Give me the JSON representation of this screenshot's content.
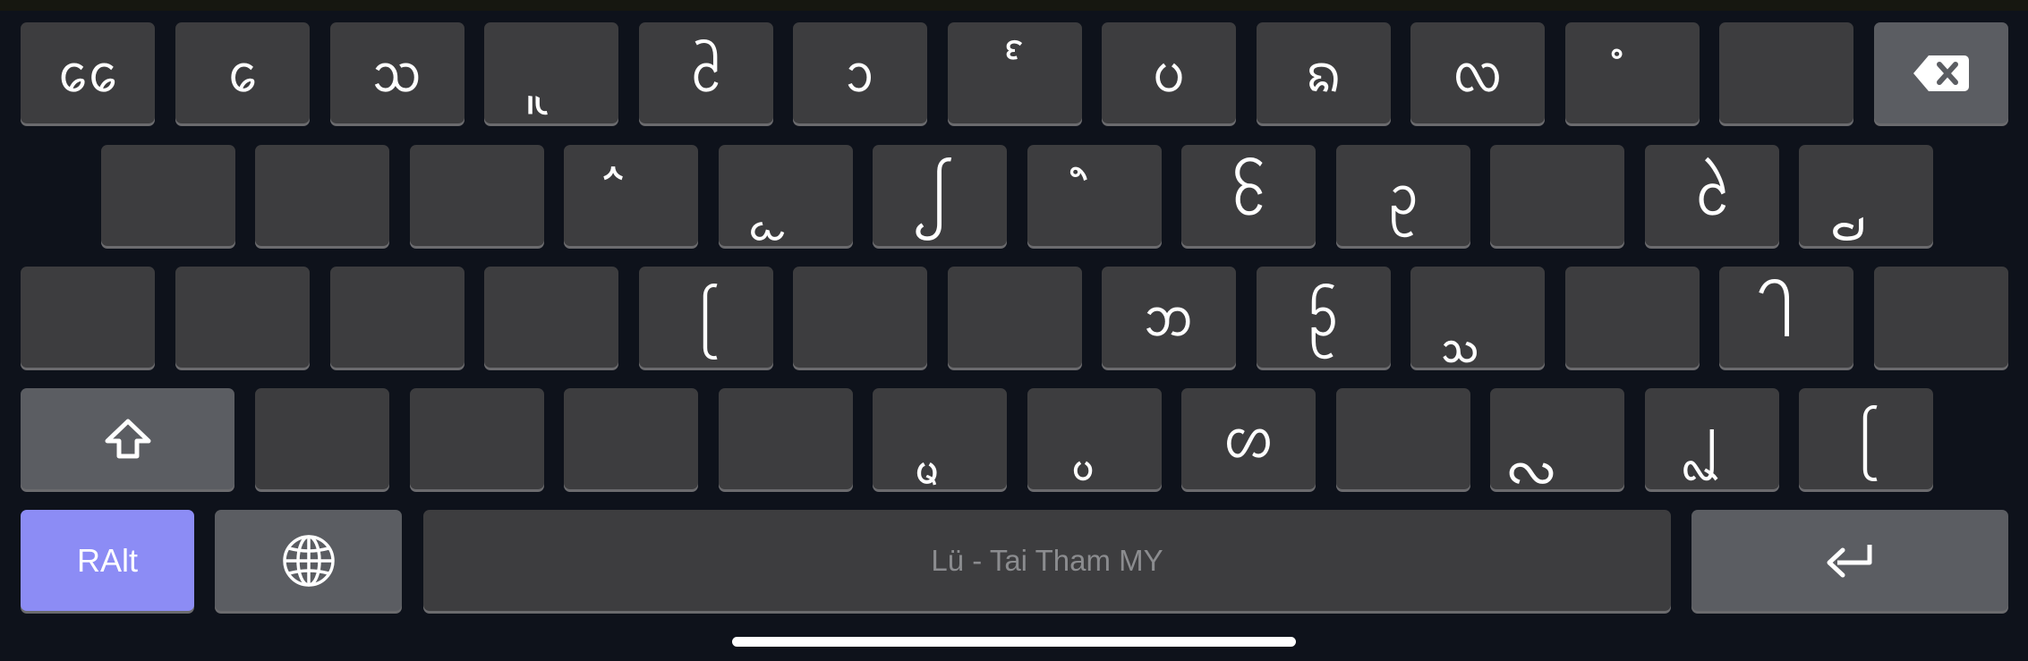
{
  "keyboard": {
    "layout_name": "Lü - Tai Tham MY",
    "rows": [
      [
        "ᩯ",
        "ᩮ",
        "ᩈ",
        "ᩪ",
        "ᩲ",
        "ᩣ",
        "ᩘ",
        "ᨷ",
        "ᨦ",
        "ᩃ",
        "ᩴ",
        "",
        "backspace"
      ],
      [
        "",
        "",
        "",
        "ᩳ",
        "ᩬ",
        "ᩭ",
        "ᩫ",
        "ᩰ",
        "ᩏ",
        "",
        "ᩱ",
        "ᩛ"
      ],
      [
        "",
        "",
        "",
        "",
        "ᩕ",
        "",
        "",
        "ᨽ",
        "ᩐ",
        "ᩞ",
        "",
        "ᩤ",
        ""
      ],
      [
        "shift",
        "",
        "",
        "",
        "",
        "ᩜ",
        "ᩝ",
        "ᩉ",
        "",
        "ᩖ",
        "ᩗ",
        "ᩕ"
      ]
    ],
    "bottom": {
      "ralt_label": "RAlt",
      "globe": "globe-icon",
      "space_label": "Lü - Tai Tham MY",
      "enter": "return-icon"
    },
    "icons": {
      "backspace": "backspace-icon",
      "shift": "shift-icon"
    },
    "colors": {
      "background": "#0e121b",
      "key": "#3d3d3f",
      "function_key": "#5b5d62",
      "ralt_key": "#8c8cf5",
      "space_label": "#8b8c8f"
    }
  }
}
